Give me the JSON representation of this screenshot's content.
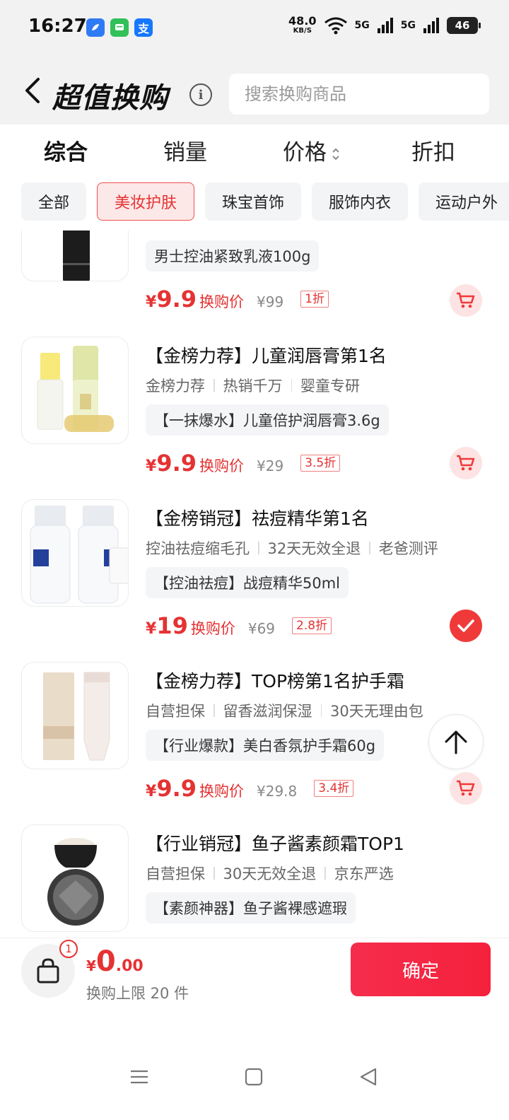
{
  "status": {
    "time": "16:27",
    "net_speed_value": "48.0",
    "net_speed_unit": "KB/S",
    "signal1": "5G",
    "signal2": "5G",
    "battery": "46",
    "app_icons": [
      "bird-app-icon",
      "message-app-icon",
      "alipay-app-icon"
    ]
  },
  "header": {
    "title": "超值换购",
    "search_placeholder": "搜索换购商品"
  },
  "sort_tabs": [
    "综合",
    "销量",
    "价格",
    "折扣"
  ],
  "categories": [
    "全部",
    "美妆护肤",
    "珠宝首饰",
    "服饰内衣",
    "运动户外"
  ],
  "active_category": "美妆护肤",
  "products": [
    {
      "title": "",
      "tags": [],
      "promo": "男士控油紧致乳液100g",
      "price": "9.9",
      "price_label": "换购价",
      "original_price": "¥99",
      "discount": "1折",
      "selected": false
    },
    {
      "title": "【金榜力荐】儿童润唇膏第1名",
      "tags": [
        "金榜力荐",
        "热销千万",
        "婴童专研"
      ],
      "promo": "【一抹爆水】儿童倍护润唇膏3.6g",
      "price": "9.9",
      "price_label": "换购价",
      "original_price": "¥29",
      "discount": "3.5折",
      "selected": false
    },
    {
      "title": "【金榜销冠】祛痘精华第1名",
      "tags": [
        "控油祛痘缩毛孔",
        "32天无效全退",
        "老爸测评"
      ],
      "promo": "【控油祛痘】战痘精华50ml",
      "price": "19",
      "price_label": "换购价",
      "original_price": "¥69",
      "discount": "2.8折",
      "selected": true
    },
    {
      "title": "【金榜力荐】TOP榜第1名护手霜",
      "tags": [
        "自营担保",
        "留香滋润保湿",
        "30天无理由包"
      ],
      "promo": "【行业爆款】美白香氛护手霜60g",
      "price": "9.9",
      "price_label": "换购价",
      "original_price": "¥29.8",
      "discount": "3.4折",
      "selected": false
    },
    {
      "title": "【行业销冠】鱼子酱素颜霜TOP1",
      "tags": [
        "自营担保",
        "30天无效全退",
        "京东严选"
      ],
      "promo": "【素颜神器】鱼子酱裸感遮瑕",
      "price": "",
      "price_label": "",
      "original_price": "",
      "discount": "",
      "selected": false
    }
  ],
  "bottom": {
    "badge": "1",
    "currency": "¥",
    "total_int": "0",
    "total_dec": ".00",
    "limit_text": "换购上限 20 件",
    "confirm": "确定"
  },
  "colors": {
    "accent": "#e53232",
    "header_bg": "#f2f2f2",
    "chip_bg": "#f3f4f6"
  }
}
